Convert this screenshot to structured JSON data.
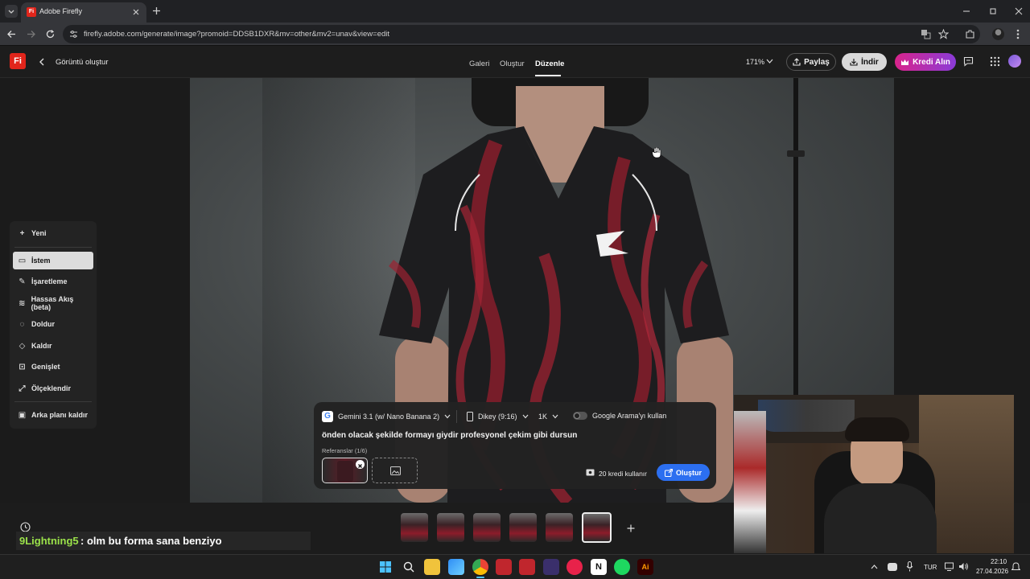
{
  "browser": {
    "tab_title": "Adobe Firefly",
    "url": "firefly.adobe.com/generate/image?promoid=DDSB1DXR&mv=other&mv2=unav&view=edit"
  },
  "header": {
    "logo": "Fi",
    "back_label": "Görüntü oluştur",
    "nav": [
      "Galeri",
      "Oluştur",
      "Düzenle"
    ],
    "active_nav": "Düzenle",
    "zoom": "171%",
    "share_label": "Paylaş",
    "download_label": "İndir",
    "credits_label": "Kredi Alın",
    "colors": {
      "credits_gradient_start": "#d9248b",
      "credits_gradient_end": "#7a3bd8",
      "accent_blue": "#2c6ff0"
    }
  },
  "tools": {
    "new_label": "Yeni",
    "items": [
      {
        "label": "İstem",
        "icon": "prompt-icon",
        "active": true
      },
      {
        "label": "İşaretleme",
        "icon": "markup-icon"
      },
      {
        "label": "Hassas Akış (beta)",
        "icon": "precision-flow-icon"
      },
      {
        "label": "Doldur",
        "icon": "fill-icon"
      },
      {
        "label": "Kaldır",
        "icon": "remove-icon"
      },
      {
        "label": "Genişlet",
        "icon": "expand-icon"
      },
      {
        "label": "Ölçeklendir",
        "icon": "upscale-icon"
      },
      {
        "label": "Arka planı kaldır",
        "icon": "remove-background-icon"
      }
    ]
  },
  "prompt_panel": {
    "model": "Gemini 3.1 (w/ Nano Banana 2)",
    "aspect": "Dikey (9:16)",
    "resolution": "1K",
    "google_search_label": "Google Arama'yı kullan",
    "prompt_text": "önden olacak şekilde formayı giydir profesyonel çekim gibi dursun",
    "references_label": "Referanslar (1/6)",
    "credits_use": "20 kredi kullanır",
    "generate_label": "Oluştur"
  },
  "chat": {
    "user": "9Lightning5",
    "message": ": olm bu forma sana benziyo"
  },
  "taskbar": {
    "lang": "TUR",
    "time": "22:10",
    "date": "27.04.2026"
  }
}
